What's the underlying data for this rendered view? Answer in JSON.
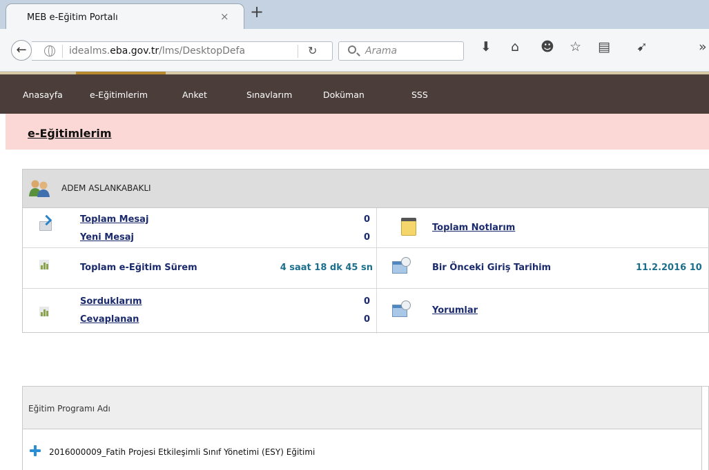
{
  "browser": {
    "tab_title": "MEB e-Eğitim Portalı",
    "tab_close": "×",
    "new_tab": "+",
    "url_prefix": "idealms.",
    "url_domain": "eba.gov.tr",
    "url_path": "/lms/DesktopDefa",
    "search_placeholder": "Arama",
    "back_glyph": "←",
    "reload_glyph": "↻",
    "toolbar_icons": [
      "download-icon",
      "home-icon",
      "hello-chat-icon",
      "bookmark-star-icon",
      "reading-list-icon",
      "send-icon",
      "overflow-icon"
    ],
    "toolbar_glyphs": [
      "⬇",
      "⌂",
      "☻",
      "☆",
      "▤",
      "➹",
      "»"
    ]
  },
  "nav": {
    "items": [
      "Anasayfa",
      "e-Eğitimlerim",
      "Anket",
      "Sınavlarım",
      "Doküman",
      "SSS"
    ]
  },
  "page": {
    "title": "e-Eğitimlerim"
  },
  "user_panel": {
    "name": "ADEM ASLANKABAKLI",
    "total_messages_label": "Toplam Mesaj",
    "total_messages": "0",
    "new_messages_label": "Yeni Mesaj",
    "new_messages": "0",
    "notes_label": "Toplam Notlarım",
    "training_time_label": "Toplam e-Eğitim Sürem",
    "training_time": "4 saat 18 dk 45 sn",
    "previous_login_label": "Bir Önceki Giriş Tarihim",
    "previous_login": "11.2.2016 10",
    "asked_label": "Sorduklarım",
    "asked": "0",
    "answered_label": "Cevaplanan",
    "answered": "0",
    "comments_label": "Yorumlar"
  },
  "programs": {
    "column_header": "Eğitim Programı Adı",
    "rows": [
      "2016000009_Fatih Projesi Etkileşimli Sınıf Yönetimi (ESY) Eğitimi"
    ]
  },
  "colors": {
    "nav_bg": "#4a3d3a",
    "title_bar_bg": "#fbd7d5",
    "link": "#1a2a6c",
    "value_teal": "#1c6f8c",
    "expand_blue": "#2b8fd8"
  }
}
